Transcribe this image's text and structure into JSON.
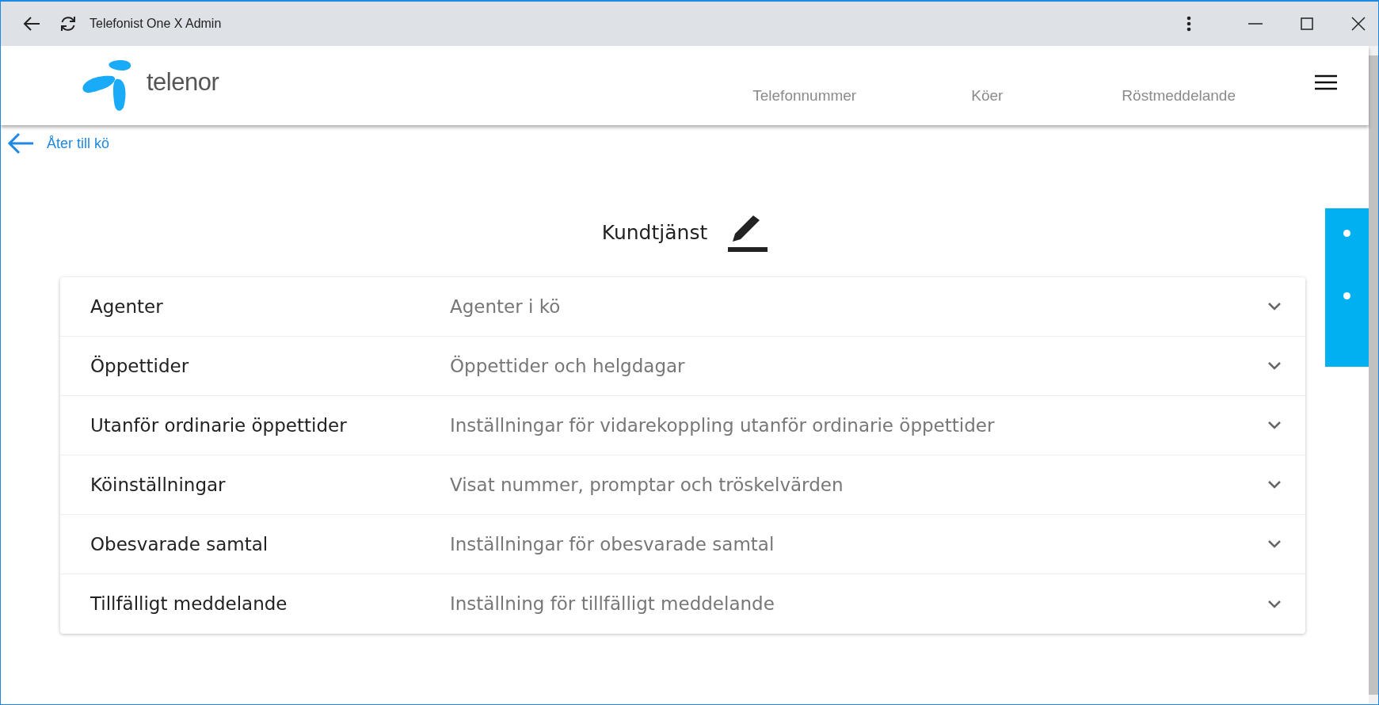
{
  "window": {
    "title": "Telefonist One X Admin"
  },
  "header": {
    "logo_text": "telenor",
    "nav": [
      {
        "label": "Telefonnummer"
      },
      {
        "label": "Köer"
      },
      {
        "label": "Röstmeddelande"
      }
    ]
  },
  "back_link": {
    "label": "Åter till kö"
  },
  "queue": {
    "name": "Kundtjänst"
  },
  "sections": [
    {
      "title": "Agenter",
      "description": "Agenter i kö",
      "expanded": false
    },
    {
      "title": "Öppettider",
      "description": "Öppettider och helgdagar",
      "expanded": false
    },
    {
      "title": "Utanför ordinarie öppettider",
      "description": "Inställningar för vidarekoppling utanför ordinarie öppettider",
      "expanded": false
    },
    {
      "title": "Köinställningar",
      "description": "Visat nummer, promptar och tröskelvärden",
      "expanded": false
    },
    {
      "title": "Obesvarade samtal",
      "description": "Inställningar för obesvarade samtal",
      "expanded": false
    },
    {
      "title": "Tillfälligt meddelande",
      "description": "Inställning för tillfälligt meddelande",
      "expanded": false
    }
  ]
}
